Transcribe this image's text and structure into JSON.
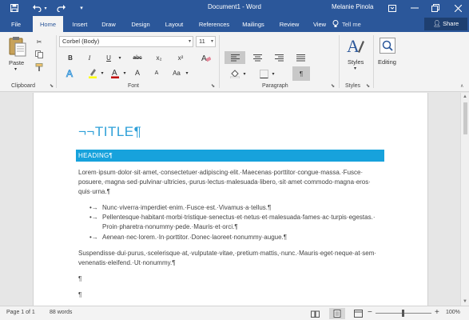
{
  "titlebar": {
    "title": "Document1 - Word",
    "user": "Melanie Pinola",
    "save_icon": "save-icon",
    "undo_icon": "undo-icon",
    "redo_icon": "redo-icon",
    "customize_icon": "chevron-down-icon",
    "ribbon_options_icon": "ribbon-display-icon",
    "minimize_icon": "minimize-icon",
    "restore_icon": "restore-icon",
    "close_icon": "close-icon"
  },
  "tabs": [
    "File",
    "Home",
    "Insert",
    "Draw",
    "Design",
    "Layout",
    "References",
    "Mailings",
    "Review",
    "View"
  ],
  "active_tab": "Home",
  "tell_me": "Tell me",
  "share": "Share",
  "ribbon": {
    "clipboard": {
      "label": "Clipboard",
      "paste": "Paste"
    },
    "font": {
      "label": "Font",
      "font_name": "Corbel (Body)",
      "font_size": "11",
      "bold": "B",
      "italic": "I",
      "underline": "U",
      "strike": "abc",
      "subscript": "x₂",
      "superscript": "x²",
      "grow": "A",
      "shrink": "A",
      "case": "Aa",
      "font_color_accent": "#c00000",
      "highlight_accent": "#ffff00"
    },
    "paragraph": {
      "label": "Paragraph",
      "show_marks": "¶"
    },
    "styles": {
      "label": "Styles",
      "button": "Styles"
    },
    "editing": {
      "button": "Editing"
    }
  },
  "document": {
    "title": "¬¬TITLE¶",
    "heading": "HEADING¶",
    "para1_lines": [
      "Lorem·ipsum·dolor·sit·amet,·consectetuer·adipiscing·elit.·Maecenas·porttitor·congue·massa.·Fusce·",
      "posuere,·magna·sed·pulvinar·ultricies,·purus·lectus·malesuada·libero,·sit·amet·commodo·magna·eros·",
      "quis·urna.¶"
    ],
    "bullets": [
      {
        "marker": "•→",
        "lines": [
          "Nunc·viverra·imperdiet·enim.·Fusce·est.·Vivamus·a·tellus.¶"
        ]
      },
      {
        "marker": "•→",
        "lines": [
          "Pellentesque·habitant·morbi·tristique·senectus·et·netus·et·malesuada·fames·ac·turpis·egestas.·",
          "Proin·pharetra·nonummy·pede.·Mauris·et·orci.¶"
        ]
      },
      {
        "marker": "•→",
        "lines": [
          "Aenean·nec·lorem.·In·porttitor.·Donec·laoreet·nonummy·augue.¶"
        ]
      }
    ],
    "para2_lines": [
      "Suspendisse·dui·purus,·scelerisque·at,·vulputate·vitae,·pretium·mattis,·nunc.·Mauris·eget·neque·at·sem·",
      "venenatis·eleifend.·Ut·nonummy.¶"
    ],
    "empty_para_1": "¶",
    "empty_para_2": "¶"
  },
  "status": {
    "page": "Page 1 of 1",
    "words": "88 words",
    "zoom": "100%",
    "zoom_minus": "−",
    "zoom_plus": "+"
  },
  "colors": {
    "brand": "#2b579a",
    "title_blue": "#2ea0d8",
    "heading_bar": "#17a2dc"
  }
}
